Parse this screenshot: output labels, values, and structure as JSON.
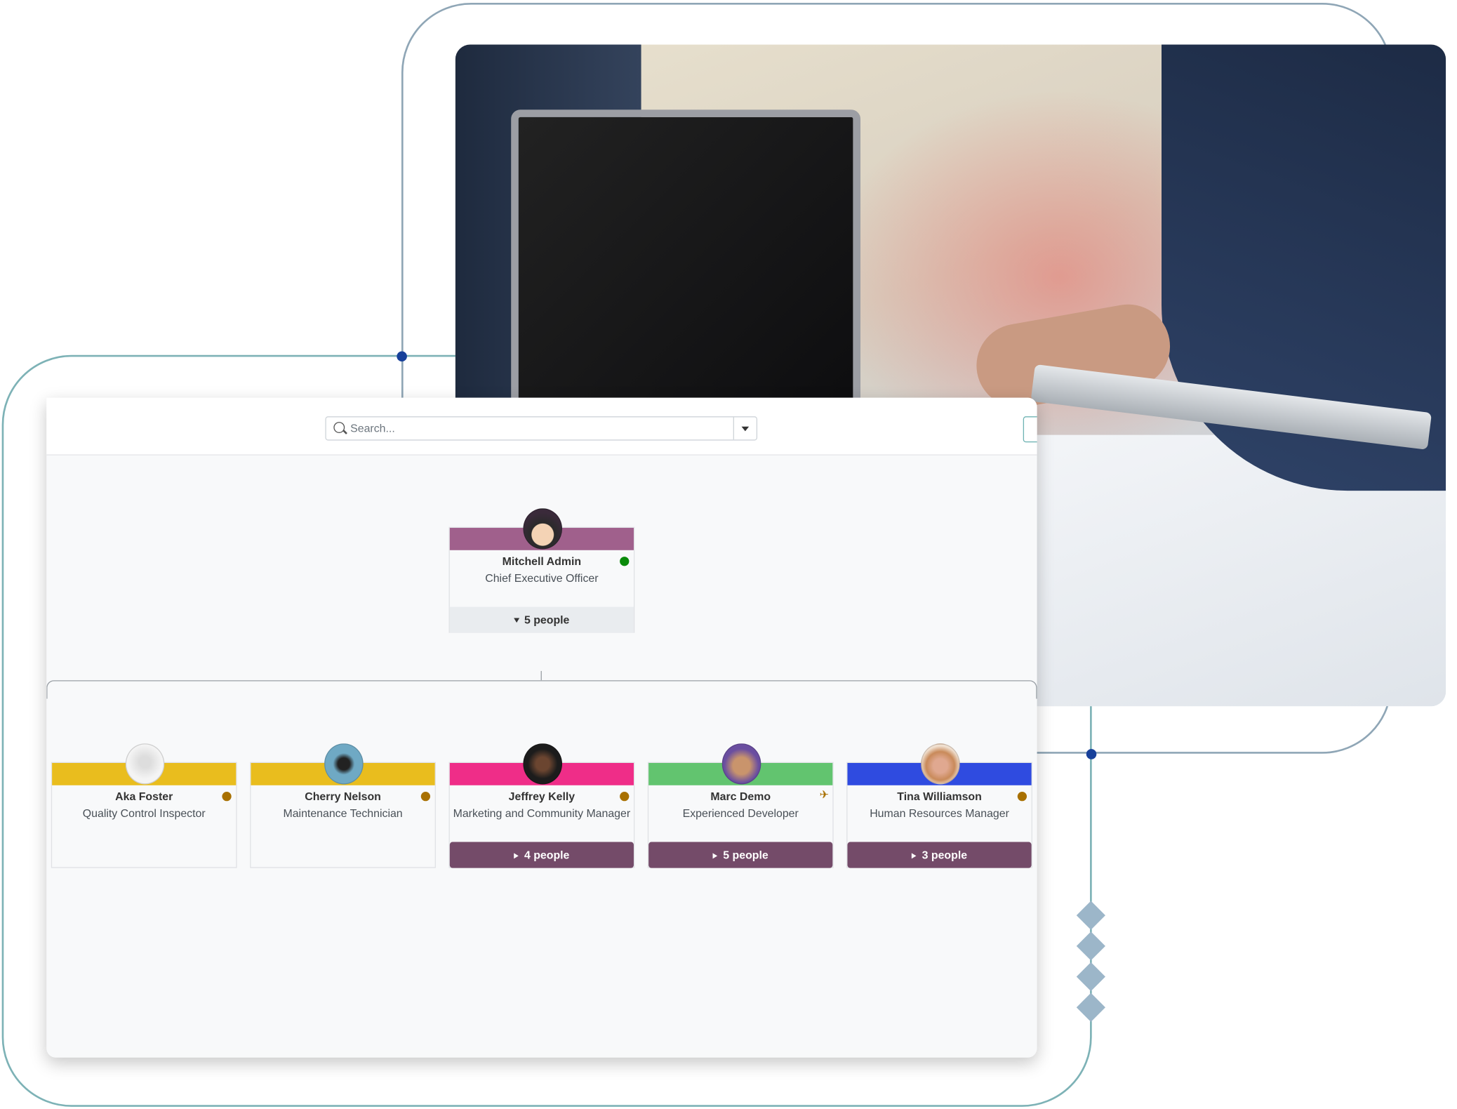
{
  "search": {
    "placeholder": "Search..."
  },
  "colors": {
    "accent": "#744b69",
    "online": "#0a8a0a",
    "away": "#a87000",
    "frame": "#8fa6b6",
    "frame_teal": "#7db2b6",
    "marker": "#17409a"
  },
  "root": {
    "name": "Mitchell Admin",
    "job_title": "Chief Executive Officer",
    "status": "online",
    "reports_label": "5 people",
    "bar_color": "#a0608c",
    "avatar_icon": "cartoon-avatar"
  },
  "children": [
    {
      "name": "Aka Foster",
      "job_title": "Quality Control Inspector",
      "status": "away",
      "bar_color": "#e9bd1e"
    },
    {
      "name": "Cherry Nelson",
      "job_title": "Maintenance Technician",
      "status": "away",
      "bar_color": "#e9bd1e"
    },
    {
      "name": "Jeffrey Kelly",
      "job_title": "Marketing and Community Manager",
      "status": "away",
      "bar_color": "#ef2d88",
      "reports_label": "4 people"
    },
    {
      "name": "Marc Demo",
      "job_title": "Experienced Developer",
      "status": "on-leave",
      "status_icon": "plane-icon",
      "bar_color": "#62c46f",
      "reports_label": "5 people"
    },
    {
      "name": "Tina Williamson",
      "job_title": "Human Resources Manager",
      "status": "away",
      "bar_color": "#2f4be0",
      "reports_label": "3 people"
    }
  ]
}
